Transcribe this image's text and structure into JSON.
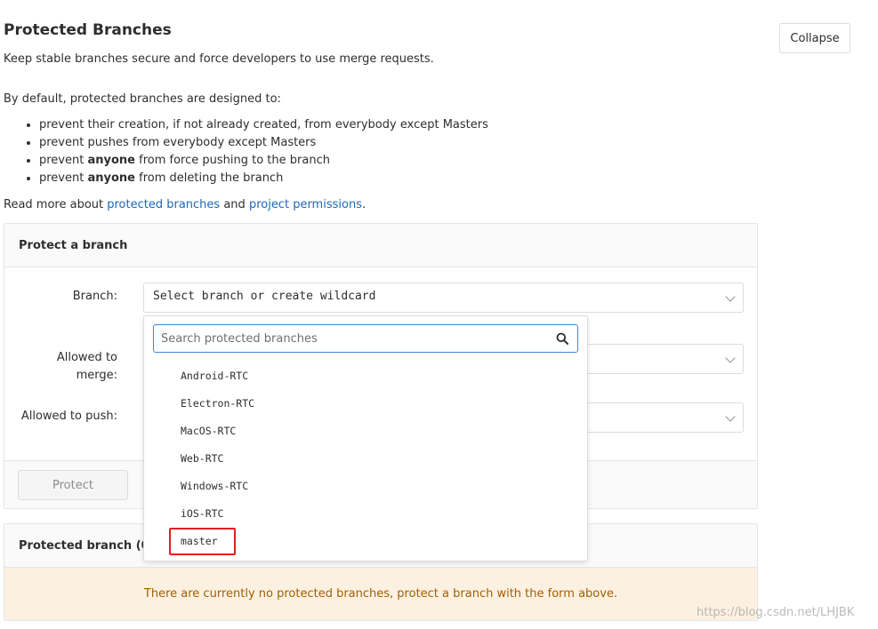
{
  "header": {
    "title": "Protected Branches",
    "subtitle": "Keep stable branches secure and force developers to use merge requests.",
    "collapse_label": "Collapse"
  },
  "intro": "By default, protected branches are designed to:",
  "rules": [
    {
      "pre": "prevent their creation, if not already created, from everybody except Masters",
      "bold": "",
      "post": ""
    },
    {
      "pre": "prevent pushes from everybody except Masters",
      "bold": "",
      "post": ""
    },
    {
      "pre": "prevent ",
      "bold": "anyone",
      "post": " from force pushing to the branch"
    },
    {
      "pre": "prevent ",
      "bold": "anyone",
      "post": " from deleting the branch"
    }
  ],
  "readmore": {
    "prefix": "Read more about ",
    "link1": "protected branches",
    "middle": " and ",
    "link2": "project permissions",
    "suffix": "."
  },
  "protect_panel": {
    "title": "Protect a branch",
    "branch_label": "Branch:",
    "branch_value": "Select branch or create wildcard",
    "merge_label_1": "Allowed to",
    "merge_label_2": "merge:",
    "push_label": "Allowed to push:",
    "protect_label": "Protect"
  },
  "dropdown": {
    "search_placeholder": "Search protected branches",
    "items": [
      "Android-RTC",
      "Electron-RTC",
      "MacOS-RTC",
      "Web-RTC",
      "Windows-RTC",
      "iOS-RTC",
      "master"
    ],
    "highlighted": "master"
  },
  "protected_panel": {
    "title": "Protected branch (0)",
    "empty_message": "There are currently no protected branches, protect a branch with the form above."
  },
  "watermark": "https://blog.csdn.net/LHJBK",
  "colors": {
    "link": "#1b69b6",
    "search_focus": "#3e86d4",
    "warning_bg": "#fcf1e1",
    "warning_text": "#a35e00",
    "highlight": "#e02020"
  }
}
